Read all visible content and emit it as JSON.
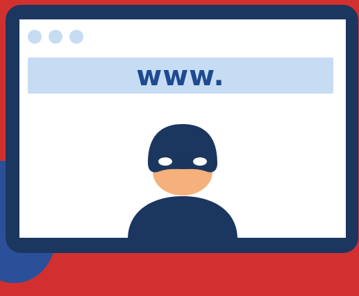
{
  "browser": {
    "url_text": "www.",
    "window_dots": [
      "dot-1",
      "dot-2",
      "dot-3"
    ]
  },
  "illustration": {
    "subject": "masked-hacker-icon",
    "colors": {
      "background": "#d2302f",
      "frame": "#1b365f",
      "accent": "#c6dcf3",
      "text": "#1f4a8f",
      "skin": "#f6b07c",
      "mask": "#1b365f"
    }
  }
}
